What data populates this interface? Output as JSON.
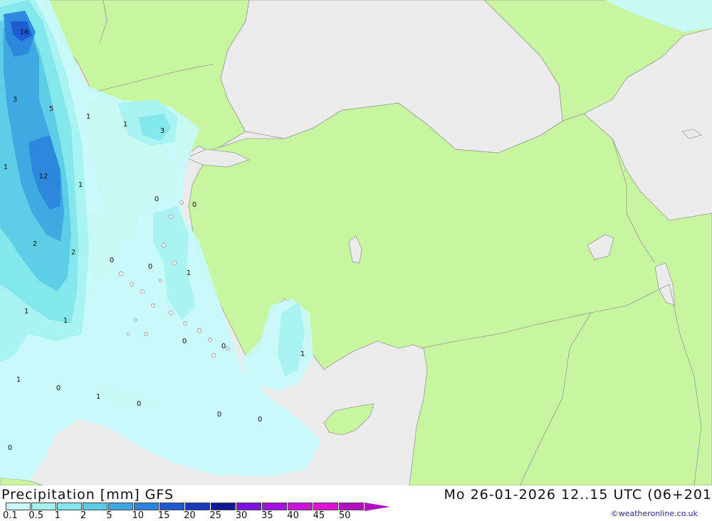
{
  "legend": {
    "title": "Precipitation [mm]  GFS",
    "time": "Mo 26-01-2026 12..15 UTC (06+201",
    "credit": "©weatheronline.co.uk",
    "scale": [
      {
        "label": "0.1",
        "color": "#c8fafa"
      },
      {
        "label": "0.5",
        "color": "#a6f2f2"
      },
      {
        "label": "1",
        "color": "#82e6ea"
      },
      {
        "label": "2",
        "color": "#5ccce6"
      },
      {
        "label": "5",
        "color": "#3ea6e2"
      },
      {
        "label": "10",
        "color": "#2a86dc"
      },
      {
        "label": "15",
        "color": "#1f5ad0"
      },
      {
        "label": "20",
        "color": "#1a38bd"
      },
      {
        "label": "25",
        "color": "#121699"
      },
      {
        "label": "30",
        "color": "#7c10e6"
      },
      {
        "label": "35",
        "color": "#a410e6"
      },
      {
        "label": "40",
        "color": "#cc10e0"
      },
      {
        "label": "45",
        "color": "#e010d8"
      },
      {
        "label": "50",
        "color": "#b010c0"
      }
    ]
  },
  "colors": {
    "land": "#c8f5a0",
    "sea": "#ececec",
    "border": "#9a9a9a"
  },
  "values": [
    {
      "text": "16"
    },
    {
      "text": "3"
    },
    {
      "text": "5"
    },
    {
      "text": "1"
    },
    {
      "text": "1"
    },
    {
      "text": "3"
    },
    {
      "text": "1"
    },
    {
      "text": "12"
    },
    {
      "text": "1"
    },
    {
      "text": "0"
    },
    {
      "text": "0"
    },
    {
      "text": "2"
    },
    {
      "text": "2"
    },
    {
      "text": "0"
    },
    {
      "text": "0"
    },
    {
      "text": "1"
    },
    {
      "text": "1"
    },
    {
      "text": "1"
    },
    {
      "text": "0"
    },
    {
      "text": "0"
    },
    {
      "text": "1"
    },
    {
      "text": "1"
    },
    {
      "text": "0"
    },
    {
      "text": "1"
    },
    {
      "text": "0"
    },
    {
      "text": "0"
    },
    {
      "text": "0"
    },
    {
      "text": "0"
    }
  ]
}
